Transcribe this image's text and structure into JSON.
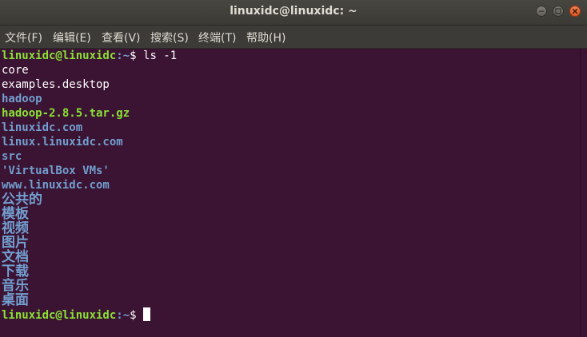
{
  "window": {
    "title": "linuxidc@linuxidc: ~"
  },
  "menu": [
    {
      "label": "文件(F)"
    },
    {
      "label": "编辑(E)"
    },
    {
      "label": "查看(V)"
    },
    {
      "label": "搜索(S)"
    },
    {
      "label": "终端(T)"
    },
    {
      "label": "帮助(H)"
    }
  ],
  "terminal": {
    "prompt_user": "linuxidc@linuxidc",
    "prompt_path": ":~",
    "prompt_symbol": "$ ",
    "command": "ls -1",
    "entries": [
      {
        "name": "core",
        "kind": "file"
      },
      {
        "name": "examples.desktop",
        "kind": "file"
      },
      {
        "name": "hadoop",
        "kind": "dir"
      },
      {
        "name": "hadoop-2.8.5.tar.gz",
        "kind": "archive"
      },
      {
        "name": "linuxidc.com",
        "kind": "dir"
      },
      {
        "name": "linux.linuxidc.com",
        "kind": "dir"
      },
      {
        "name": "src",
        "kind": "dir"
      },
      {
        "name": "'VirtualBox VMs'",
        "kind": "dir"
      },
      {
        "name": "www.linuxidc.com",
        "kind": "dir"
      },
      {
        "name": "公共的",
        "kind": "dir"
      },
      {
        "name": "模板",
        "kind": "dir"
      },
      {
        "name": "视频",
        "kind": "dir"
      },
      {
        "name": "图片",
        "kind": "dir"
      },
      {
        "name": "文档",
        "kind": "dir"
      },
      {
        "name": "下载",
        "kind": "dir"
      },
      {
        "name": "音乐",
        "kind": "dir"
      },
      {
        "name": "桌面",
        "kind": "dir"
      }
    ]
  },
  "colors": {
    "background": "#3b1333",
    "prompt_user": "#8ae234",
    "prompt_path": "#729fcf",
    "directory": "#729fcf",
    "archive": "#8ae234",
    "file": "#ffffff"
  },
  "icons": {
    "minimize": "minimize-icon",
    "maximize": "maximize-icon",
    "close": "close-icon"
  }
}
